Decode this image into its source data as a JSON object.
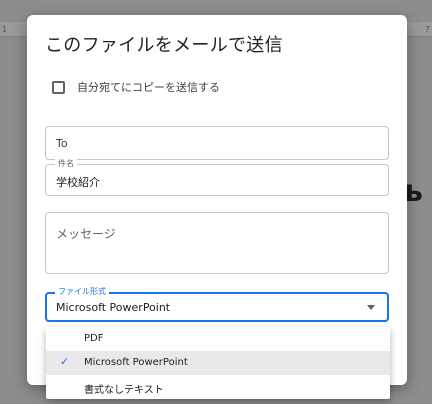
{
  "background": {
    "ruler_left": "1",
    "ruler_right": "7",
    "doc_glyph": "ь"
  },
  "dialog": {
    "title": "このファイルをメールで送信",
    "self_copy_label": "自分宛てにコピーを送信する",
    "self_copy_checked": false,
    "to_placeholder": "To",
    "subject_label": "件名",
    "subject_value": "学校紹介",
    "message_placeholder": "メッセージ",
    "file_format_label": "ファイル形式",
    "file_format_value": "Microsoft PowerPoint"
  },
  "format_menu": {
    "options": [
      {
        "label": "PDF",
        "selected": false
      },
      {
        "label": "Microsoft PowerPoint",
        "selected": true
      },
      {
        "label": "書式なしテキスト",
        "selected": false
      }
    ]
  },
  "colors": {
    "accent": "#1a73e8",
    "selected_row": "#e9e9e9"
  }
}
